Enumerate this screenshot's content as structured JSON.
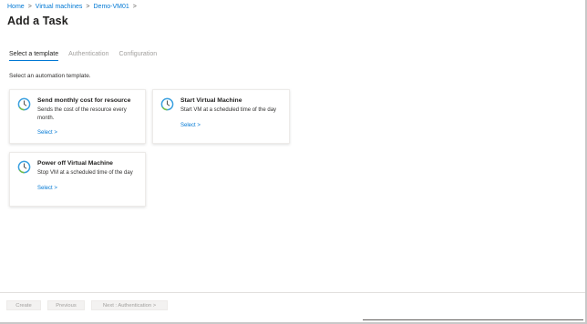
{
  "breadcrumb": {
    "items": [
      "Home",
      "Virtual machines",
      "Demo-VM01"
    ],
    "separator": ">"
  },
  "page": {
    "title": "Add a Task"
  },
  "tabs": [
    {
      "label": "Select a template",
      "active": true
    },
    {
      "label": "Authentication",
      "active": false
    },
    {
      "label": "Configuration",
      "active": false
    }
  ],
  "instruction": "Select an automation template.",
  "templates": [
    {
      "title": "Send monthly cost for resource",
      "description": "Sends the cost of the resource every month.",
      "select_label": "Select >",
      "icon": "clock-icon"
    },
    {
      "title": "Start Virtual Machine",
      "description": "Start VM at a scheduled time of the day",
      "select_label": "Select >",
      "icon": "clock-icon"
    },
    {
      "title": "Power off Virtual Machine",
      "description": "Stop VM at a scheduled time of the day",
      "select_label": "Select >",
      "icon": "clock-icon"
    }
  ],
  "footer": {
    "create_label": "Create",
    "previous_label": "Previous",
    "next_label": "Next : Authentication >"
  },
  "colors": {
    "accent": "#0078d4",
    "clock_ring": "#3aa0e0",
    "clock_ring_green": "#7cc242"
  }
}
